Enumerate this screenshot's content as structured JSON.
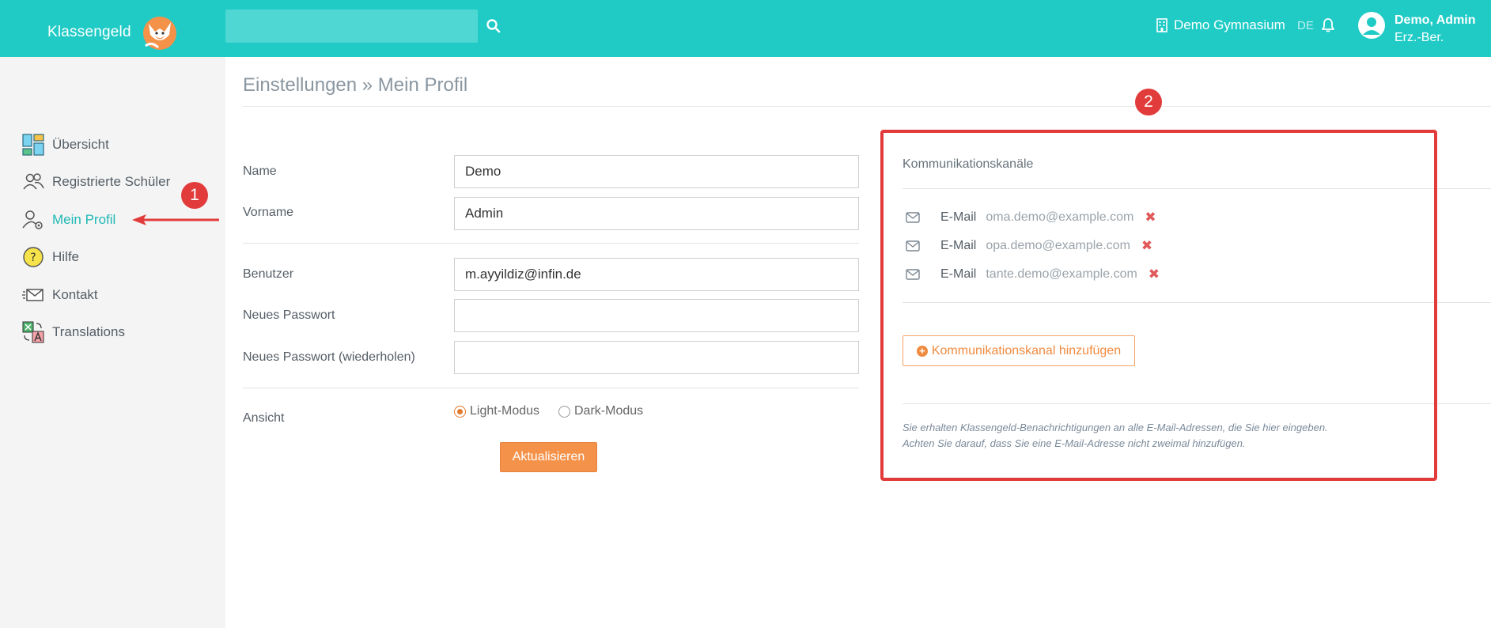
{
  "header": {
    "brand": "Klassengeld",
    "search": {
      "value": "",
      "placeholder": ""
    },
    "school": "Demo Gymnasium",
    "language": "DE",
    "user_name": "Demo, Admin",
    "user_role": "Erz.-Ber.",
    "icons": [
      "fox-logo",
      "search-icon",
      "building-icon",
      "bell-icon",
      "user-avatar-icon"
    ]
  },
  "sidebar": {
    "items": [
      {
        "label": "Übersicht",
        "icon": "dashboard-icon",
        "active": false
      },
      {
        "label": "Registrierte Schüler",
        "icon": "users-icon",
        "active": false
      },
      {
        "label": "Mein Profil",
        "icon": "user-settings-icon",
        "active": true
      },
      {
        "label": "Hilfe",
        "icon": "help-icon",
        "active": false
      },
      {
        "label": "Kontakt",
        "icon": "mail-icon",
        "active": false
      },
      {
        "label": "Translations",
        "icon": "translate-icon",
        "active": false
      }
    ]
  },
  "annotations": {
    "badge1": "1",
    "badge2": "2"
  },
  "breadcrumb": "Einstellungen » Mein Profil",
  "form": {
    "name_label": "Name",
    "name_value": "Demo",
    "vorname_label": "Vorname",
    "vorname_value": "Admin",
    "benutzer_label": "Benutzer",
    "benutzer_value": "m.ayyildiz@infin.de",
    "neues_passwort_label": "Neues Passwort",
    "neues_passwort_value": "",
    "passwort_wiederholen_label": "Neues Passwort (wiederholen)",
    "passwort_wiederholen_value": "",
    "ansicht_label": "Ansicht",
    "light_label": "Light-Modus",
    "dark_label": "Dark-Modus",
    "selected_mode": "Light-Modus",
    "update_button": "Aktualisieren"
  },
  "channels": {
    "title": "Kommunikationskanäle",
    "items": [
      {
        "type": "E-Mail",
        "address": "oma.demo@example.com"
      },
      {
        "type": "E-Mail",
        "address": "opa.demo@example.com"
      },
      {
        "type": "E-Mail",
        "address": "tante.demo@example.com"
      }
    ],
    "delete_symbol": "✖",
    "add_button": "Kommunikationskanal hinzufügen",
    "info_line1": "Sie erhalten Klassengeld-Benachrichtigungen an alle E-Mail-Adressen, die Sie hier eingeben.",
    "info_line2": "Achten Sie darauf, dass Sie eine E-Mail-Adresse nicht zweimal hinzufügen."
  },
  "colors": {
    "header_bg": "#20cbc6",
    "accent_orange": "#f5924a",
    "active_nav": "#20b9b5",
    "annotation_red": "#e23b3b",
    "delete_red": "#e05a5a"
  }
}
